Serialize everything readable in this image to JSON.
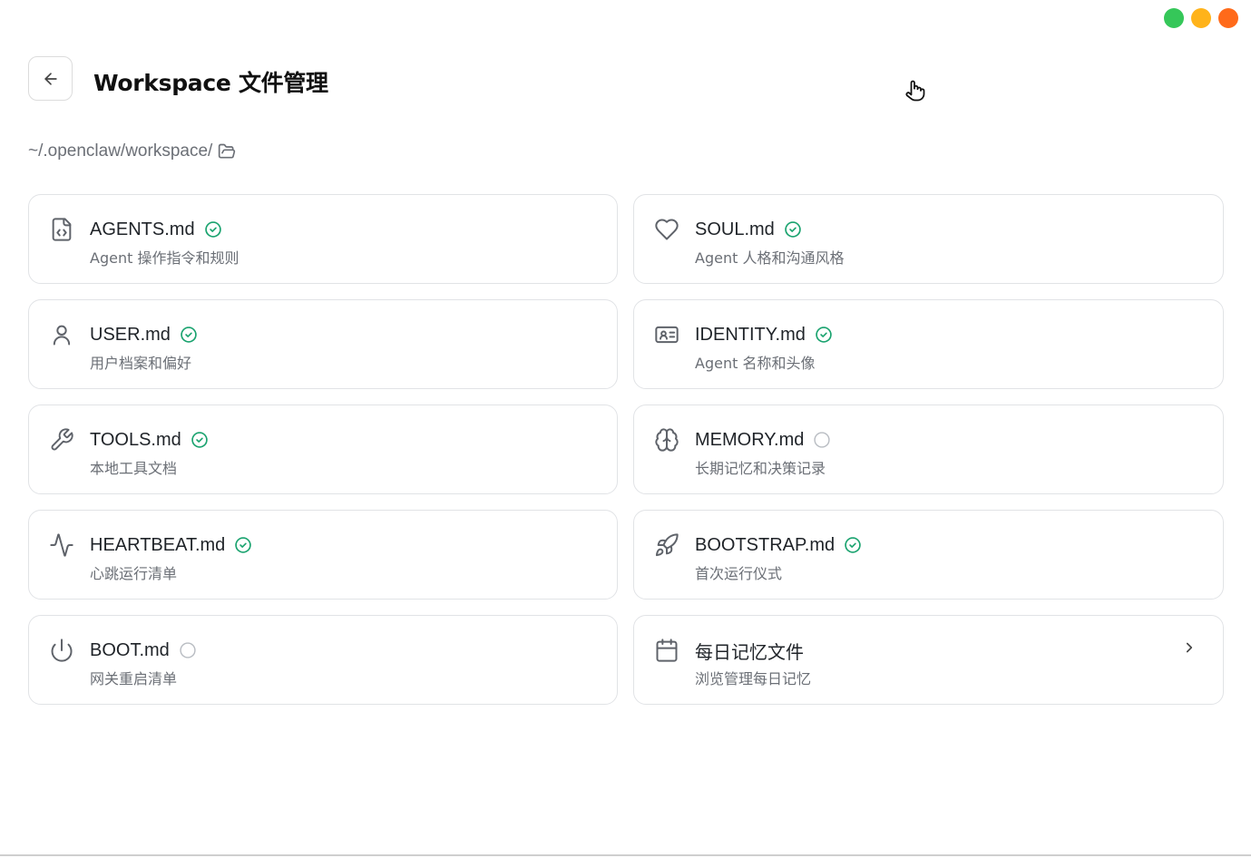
{
  "window": {
    "traffic_colors": [
      "#35c759",
      "#ffb31a",
      "#ff6a1a"
    ]
  },
  "header": {
    "back_icon": "arrow-left-icon",
    "title": "Workspace 文件管理"
  },
  "path": {
    "text": "~/.openclaw/workspace/",
    "icon": "folder-open-icon"
  },
  "colors": {
    "ok": "#1aa36f",
    "pending": "#b8bcc2",
    "icon": "#5f636a"
  },
  "cards": [
    {
      "title": "AGENTS.md",
      "desc": "Agent 操作指令和规则",
      "icon": "file-code-icon",
      "status": "ok"
    },
    {
      "title": "SOUL.md",
      "desc": "Agent 人格和沟通风格",
      "icon": "heart-icon",
      "status": "ok"
    },
    {
      "title": "USER.md",
      "desc": "用户档案和偏好",
      "icon": "user-icon",
      "status": "ok"
    },
    {
      "title": "IDENTITY.md",
      "desc": "Agent 名称和头像",
      "icon": "id-card-icon",
      "status": "ok"
    },
    {
      "title": "TOOLS.md",
      "desc": "本地工具文档",
      "icon": "wrench-icon",
      "status": "ok"
    },
    {
      "title": "MEMORY.md",
      "desc": "长期记忆和决策记录",
      "icon": "brain-icon",
      "status": "pending"
    },
    {
      "title": "HEARTBEAT.md",
      "desc": "心跳运行清单",
      "icon": "activity-icon",
      "status": "ok"
    },
    {
      "title": "BOOTSTRAP.md",
      "desc": "首次运行仪式",
      "icon": "rocket-icon",
      "status": "ok"
    },
    {
      "title": "BOOT.md",
      "desc": "网关重启清单",
      "icon": "power-icon",
      "status": "pending"
    },
    {
      "title": "每日记忆文件",
      "desc": "浏览管理每日记忆",
      "icon": "calendar-icon",
      "status": "nav"
    }
  ]
}
